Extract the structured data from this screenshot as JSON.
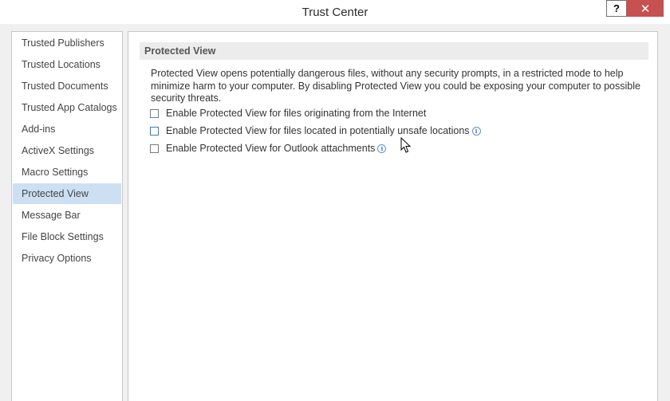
{
  "window": {
    "title": "Trust Center",
    "help_label": "?",
    "close_label": "✕"
  },
  "sidebar": {
    "items": [
      {
        "label": "Trusted Publishers"
      },
      {
        "label": "Trusted Locations"
      },
      {
        "label": "Trusted Documents"
      },
      {
        "label": "Trusted App Catalogs"
      },
      {
        "label": "Add-ins"
      },
      {
        "label": "ActiveX Settings"
      },
      {
        "label": "Macro Settings"
      },
      {
        "label": "Protected View",
        "selected": true
      },
      {
        "label": "Message Bar"
      },
      {
        "label": "File Block Settings"
      },
      {
        "label": "Privacy Options"
      }
    ]
  },
  "main": {
    "section_title": "Protected View",
    "description": "Protected View opens potentially dangerous files, without any security prompts, in a restricted mode to help minimize harm to your computer. By disabling Protected View you could be exposing your computer to possible security threats.",
    "options": [
      {
        "label": "Enable Protected View for files originating from the Internet",
        "checked": false
      },
      {
        "label": "Enable Protected View for files located in potentially unsafe locations",
        "checked": false,
        "info_icon": true
      },
      {
        "label": "Enable Protected View for Outlook attachments",
        "checked": false,
        "info_icon": true
      }
    ],
    "info_glyph": "i"
  },
  "icons": [
    "help-icon",
    "close-icon",
    "info-icon",
    "mouse-cursor-icon"
  ],
  "colors": {
    "close_button": "#c75050",
    "selected_item": "#cde0f3",
    "section_header": "#ececec"
  }
}
